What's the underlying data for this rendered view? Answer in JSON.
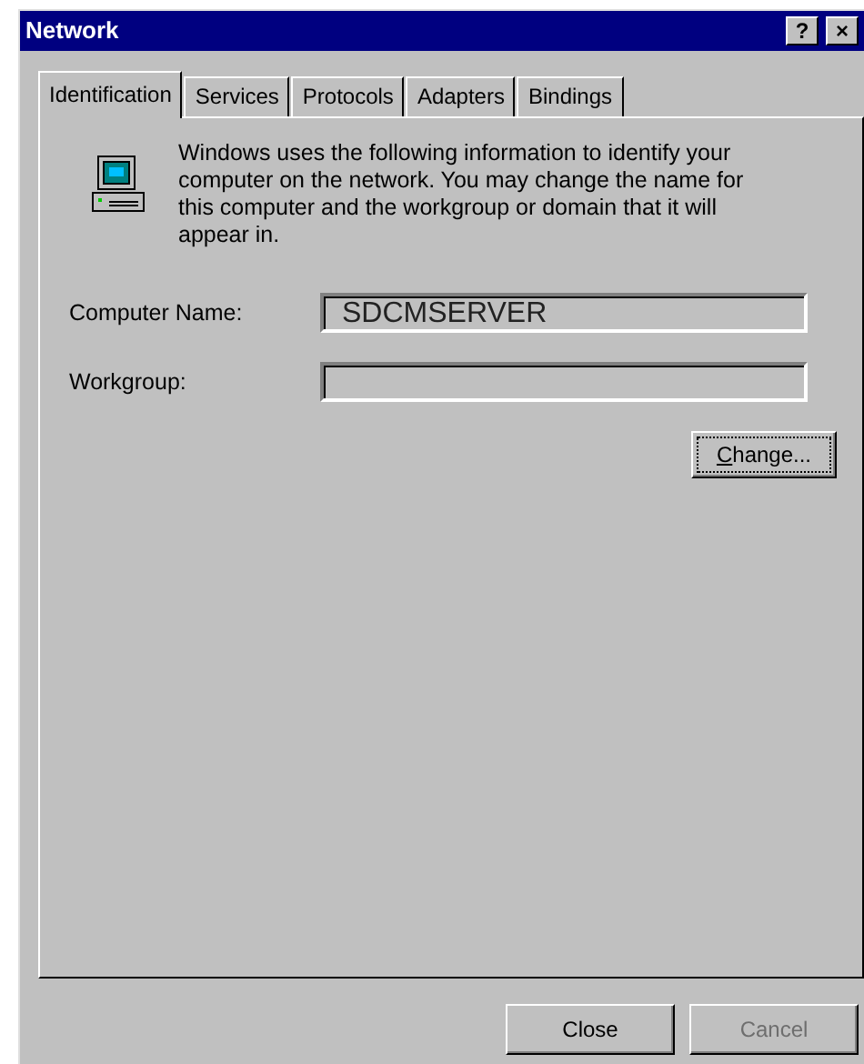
{
  "window": {
    "title": "Network",
    "help_button": "?",
    "close_button": "×"
  },
  "tabs": [
    {
      "label": "Identification",
      "selected": true
    },
    {
      "label": "Services",
      "selected": false
    },
    {
      "label": "Protocols",
      "selected": false
    },
    {
      "label": "Adapters",
      "selected": false
    },
    {
      "label": "Bindings",
      "selected": false
    }
  ],
  "description": "Windows uses the following information to identify your computer on the network.  You may change the name for this computer and the workgroup or domain that it will appear in.",
  "fields": [
    {
      "label": "Computer Name:",
      "value": "SDCMSERVER"
    },
    {
      "label": "Workgroup:"
    }
  ],
  "change_button": {
    "label": "Change...",
    "disabled": false
  },
  "buttons": [
    {
      "label": "Close",
      "disabled": false
    },
    {
      "label": "Cancel",
      "disabled": true
    }
  ]
}
